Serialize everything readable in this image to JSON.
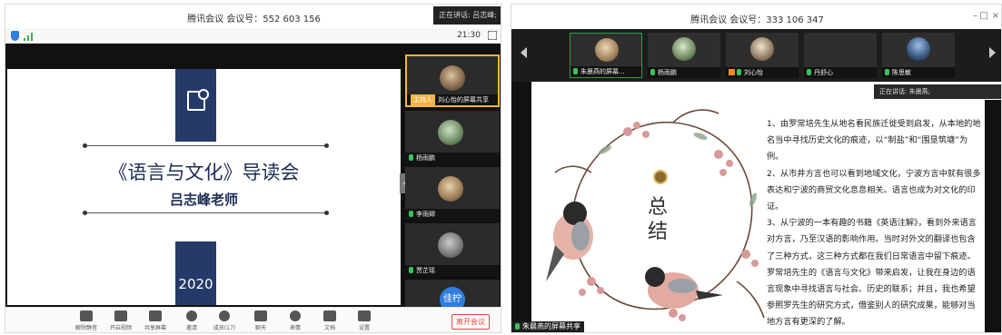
{
  "left_window": {
    "title": "腾讯会议 会议号：552 603 156",
    "speaking": "正在讲话: 吕志峰;",
    "time": "21:30",
    "slide": {
      "title": "《语言与文化》导读会",
      "teacher": "吕志峰老师",
      "year": "2020"
    },
    "participants": [
      {
        "name": "刘心怡的屏幕共享",
        "badge": "主持人",
        "active": true
      },
      {
        "name": "杨雨鹏"
      },
      {
        "name": "李雨卿"
      },
      {
        "name": "贾芷瑶"
      },
      {
        "name": "佳柠",
        "avatar_text": "佳柠"
      }
    ],
    "toolbar": [
      {
        "label": "解除静音",
        "icon": "mic-icon"
      },
      {
        "label": "开启视频",
        "icon": "video-icon"
      },
      {
        "label": "共享屏幕",
        "icon": "screen-share-icon"
      },
      {
        "label": "邀请",
        "icon": "invite-icon"
      },
      {
        "label": "成员(17)",
        "icon": "members-icon"
      },
      {
        "label": "聊天",
        "icon": "chat-icon"
      },
      {
        "label": "表情",
        "icon": "emoji-icon"
      },
      {
        "label": "文档",
        "icon": "document-icon"
      },
      {
        "label": "设置",
        "icon": "settings-icon"
      }
    ],
    "leave_label": "离开会议"
  },
  "right_window": {
    "title": "腾讯会议 会议号：333 106 347",
    "participants": [
      {
        "name": "朱晨燕的屏幕..."
      },
      {
        "name": "杨雨鹏"
      },
      {
        "name": "刘心怡"
      },
      {
        "name": "丹舒心"
      },
      {
        "name": "陈思敏"
      }
    ],
    "speaking": "正在讲话: 朱晨燕;",
    "summary": [
      "总",
      "结"
    ],
    "paragraphs": [
      "1、由罗常培先生从地名看民族迁徙受到启发，从本地的地名当中寻找历史文化的痕迹，以“制盐”和“围垦筑塘”为例。",
      "2、从市井方言也可以看到地域文化，宁波方言中就有很多表达和宁波的商贸文化息息相关。语言也成为对文化的印证。",
      "3、从宁波的一本有趣的书籍《英语注解》，看到外来语言对方言，乃至汉语的影响作用。当时对外文的翻译也包含了三种方式，这三种方式都在我们日常语言中留下痕迹。",
      "罗常培先生的《语言与文化》带来启发，让我在身边的语言现象中寻找语言与社会、历史的联系；并且，我也希望参照罗先生的研究方式，借鉴别人的研究成果，能够对当地方言有更深的了解。"
    ],
    "share_label": "朱晨燕的屏幕共享"
  }
}
